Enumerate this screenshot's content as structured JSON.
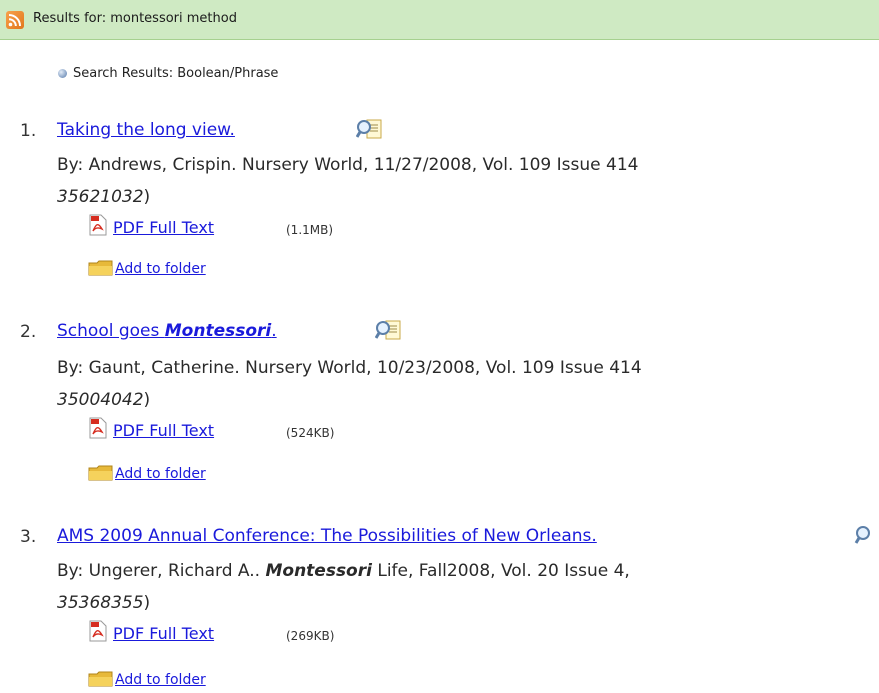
{
  "header": {
    "title": "Results for: montessori method",
    "icon": "rss-icon"
  },
  "search_mode": "Search Results: Boolean/Phrase",
  "results": [
    {
      "number": "1.",
      "title_before": "Taking the long view.",
      "title_em": "",
      "title_after": "",
      "byline_before": "By: Andrews, Crispin. Nursery World, 11/27/2008, Vol. 109 Issue 414",
      "byline_em": "",
      "byline_after": "",
      "accession_number": "35621032",
      "accession_close": ")",
      "pdf_label": "PDF Full Text",
      "pdf_size": "(1.1MB)",
      "folder_label": "Add to folder"
    },
    {
      "number": "2.",
      "title_before": "School goes ",
      "title_em": "Montessori",
      "title_after": ".",
      "byline_before": "By: Gaunt, Catherine. Nursery World, 10/23/2008, Vol. 109 Issue 414",
      "byline_em": "",
      "byline_after": "",
      "accession_number": "35004042",
      "accession_close": ")",
      "pdf_label": "PDF Full Text",
      "pdf_size": "(524KB)",
      "folder_label": "Add to folder"
    },
    {
      "number": "3.",
      "title_before": "AMS 2009 Annual Conference: The Possibilities of New Orleans.",
      "title_em": "",
      "title_after": "",
      "byline_before": "By: Ungerer, Richard A.. ",
      "byline_em": "Montessori",
      "byline_after": " Life, Fall2008, Vol. 20 Issue 4,",
      "accession_number": "35368355",
      "accession_close": ")",
      "pdf_label": "PDF Full Text",
      "pdf_size": "(269KB)",
      "folder_label": "Add to folder"
    }
  ],
  "colors": {
    "header_bg": "#cfeac3",
    "link": "#1a1adb"
  }
}
